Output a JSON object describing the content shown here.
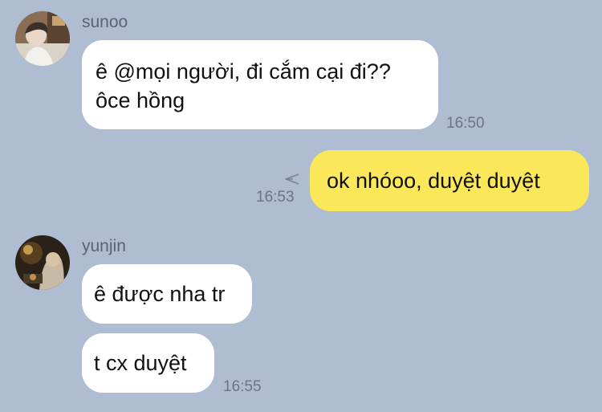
{
  "messages": [
    {
      "sender": "sunoo",
      "avatar_icon": "avatar-sunoo",
      "lines": [
        "ê @mọi người, đi cắm cại đi??",
        "ôce hồng"
      ],
      "time": "16:50"
    },
    {
      "direction": "outgoing",
      "text": "ok nhóoo, duyệt duyệt",
      "time": "16:53",
      "status_icon": "sent-arrow-icon"
    },
    {
      "sender": "yunjin",
      "avatar_icon": "avatar-yunjin",
      "bubbles": [
        "ê được nha tr",
        "t cx duyệt"
      ],
      "time": "16:55"
    }
  ],
  "colors": {
    "background": "#aebdd1",
    "incoming_bubble": "#ffffff",
    "outgoing_bubble": "#fbe85a"
  }
}
